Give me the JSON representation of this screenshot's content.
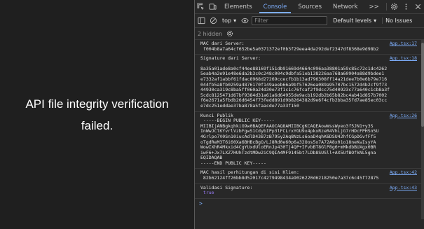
{
  "app": {
    "message": "API file integrity verification failed."
  },
  "devtools": {
    "tabs": [
      "Elements",
      "Console",
      "Sources",
      "Network",
      ">>"
    ],
    "active_tab": "Console",
    "toolbar": {
      "context": "top",
      "filter_placeholder": "Filter",
      "levels": "Default levels",
      "issues": "No Issues"
    },
    "hidden_count": "2 hidden",
    "logs": [
      {
        "head": "MAC dari Server:",
        "source": "App.tsx:17",
        "body": " f004b8a7a64cf652be5a0371372ef0b3f29eea4da292def2347df8368e9d98b2"
      },
      {
        "head": "Signature dari Server:",
        "source": "App.tsx:18",
        "body": "8a35a01ade8a0cf44ee88169f151db91669d4664c096aa38801a59c85c72c1dc4262\n5eab4a2e91e48e6da2b3c0c248c004c9dbfa51eb138226aa768a60904a88d9bdee1\ne7332af1abbf61fdac8968d27269ccecfb1b13ad796308ff14a21dee7b0e6b79e716\n044fb5a8fb0259a4876170f149aeeb66a9bf57626ea089a95707bc1572d4b2cf9f73\n44930ca319c8ba5ff060a24d30e73f1c1c76fcaf2f9dcc75d40923c77a640c1cb8a3f\n5cdc8125471d67bf9384d31a61a6d64955de9acb192db2b65b82bc4ab41d857b7002\nf6e2671a5fbdb26d6454f73fedd891d9b8264382d9e6f4cfb2bba35fd7ae85ec03cc\ne7dc251eddae37ba878a5faacde77a33f150",
        "gap": true
      },
      {
        "head": "Kunci Publik",
        "source": "App.tsx:26",
        "body": " -----BEGIN PUBLIC KEY-----\nMIIBIjANBgkqhkiG9w0BAQEFAAOCAQ8AMIIBCgKCAQEAowWssWyeo3f5JN1+y3S\nInWwJClKYvrlVzbFgwS1CdybIPp3lFCLrxYGU9x4pkxRzeR4VhLjG7rHDcFPHSn5U\n4Grlpo7V0Sn10iucAdlD43B7zB795y2Aq8NzLs6oaD4qhK6DSU42hfCGpDGvfFf5\noTgdReM3T6i60Xa6BHBcBgO/LJ8Rd0e60p6a32Oos5o7A72A8x01o18neKwIsyYA\nWowIXhR4Mkxid4CgYUxdUloERnJp430Tj4QP+IFvbBT8GlP8g6+mMkdbBUXgx0BR\niwF6+Jx7LXZ7HUhTzdtMDw2iC9QIA4MF9145bt7LDb8SUSll+AX5UfBOfkNL5gna\nEQIDAQAB\n-----END PUBLIC KEY-----"
      },
      {
        "head": "MAC hasil perhitungan di sisi Klien:",
        "source": "App.tsx:42",
        "body": " 82b62124ff26bb8d52017c4279498434a9026220d6218250e7a37c6c45f72875"
      },
      {
        "head": "Validasi Signature:",
        "source": "App.tsx:43",
        "body": " true",
        "is_bool": true
      }
    ],
    "prompt_symbol": ">"
  }
}
